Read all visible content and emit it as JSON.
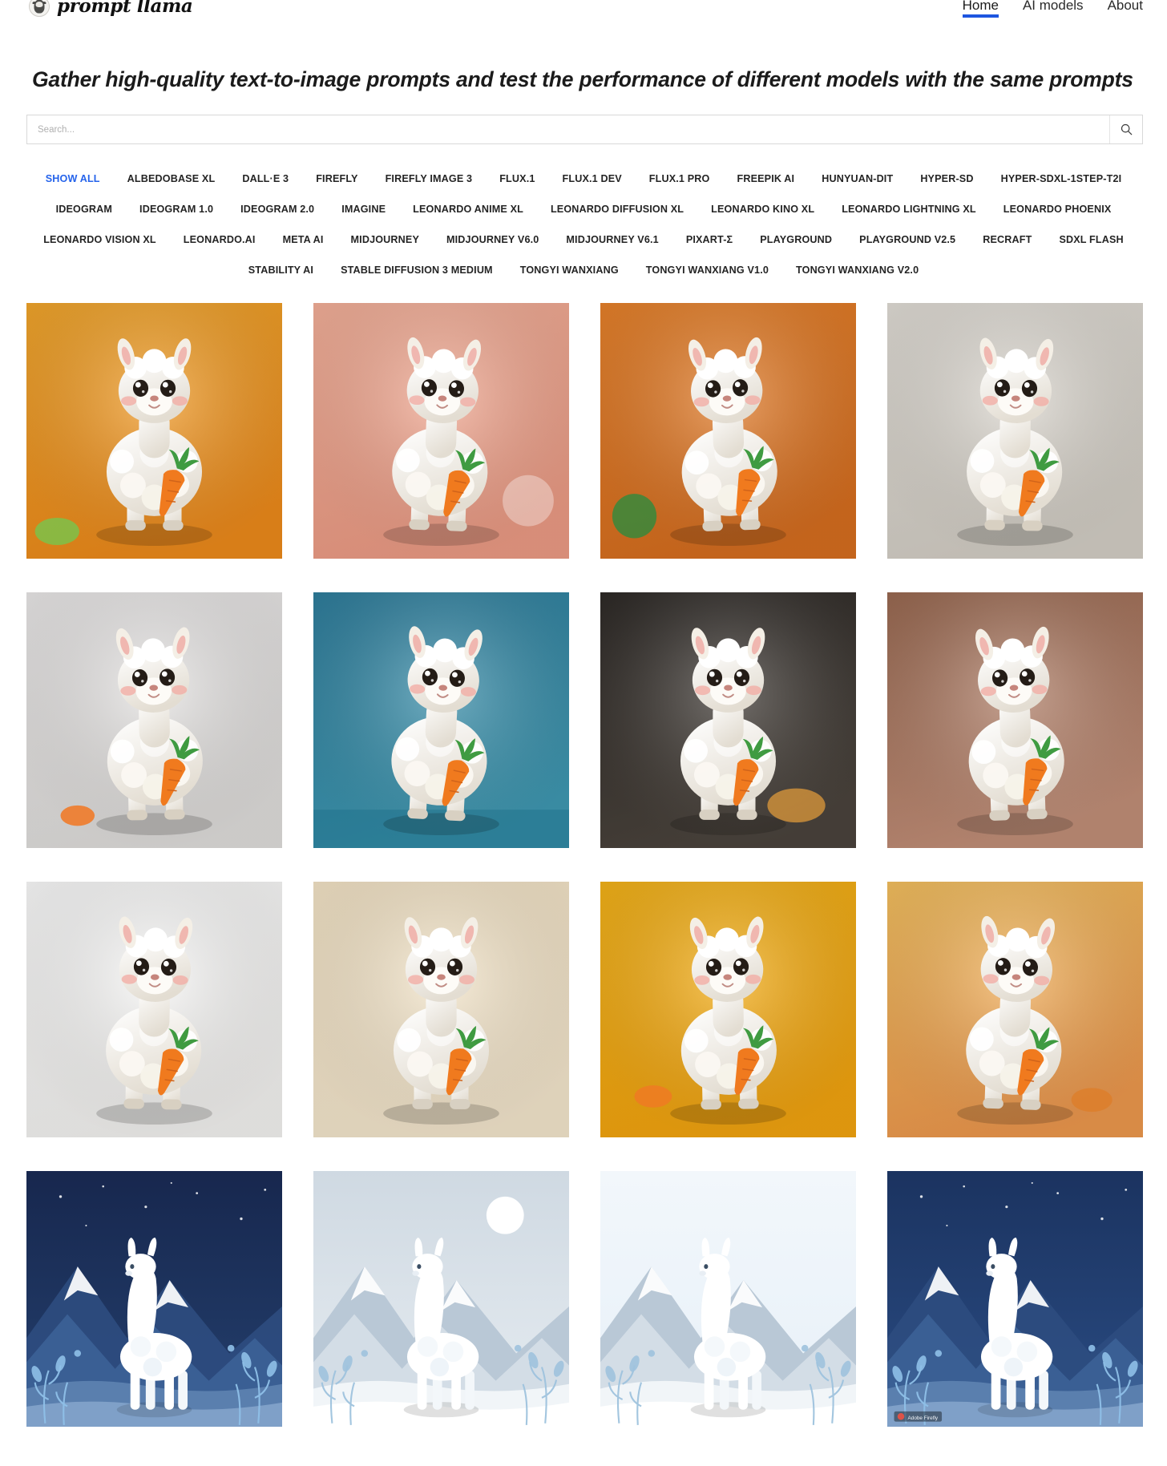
{
  "brand": {
    "name": "prompt llama",
    "logo_icon": "llama-avatar-icon"
  },
  "nav": {
    "items": [
      {
        "label": "Home",
        "active": true
      },
      {
        "label": "AI models",
        "active": false
      },
      {
        "label": "About",
        "active": false
      }
    ],
    "active_underline_color": "#1e56e0"
  },
  "headline": "Gather high-quality text-to-image prompts and test the performance of different models with the same prompts",
  "search": {
    "placeholder": "Search...",
    "value": "",
    "button_icon": "search-icon"
  },
  "filters": {
    "active": "SHOW ALL",
    "active_color": "#2563eb",
    "items": [
      "SHOW ALL",
      "ALBEDOBASE XL",
      "DALL·E 3",
      "FIREFLY",
      "FIREFLY IMAGE 3",
      "FLUX.1",
      "FLUX.1 DEV",
      "FLUX.1 PRO",
      "FREEPIK AI",
      "HUNYUAN-DIT",
      "HYPER-SD",
      "HYPER-SDXL-1STEP-T2I",
      "IDEOGRAM",
      "IDEOGRAM 1.0",
      "IDEOGRAM 2.0",
      "IMAGINE",
      "LEONARDO ANIME XL",
      "LEONARDO DIFFUSION XL",
      "LEONARDO KINO XL",
      "LEONARDO LIGHTNING XL",
      "LEONARDO PHOENIX",
      "LEONARDO VISION XL",
      "LEONARDO.AI",
      "META AI",
      "MIDJOURNEY",
      "MIDJOURNEY V6.0",
      "MIDJOURNEY V6.1",
      "PIXART-Σ",
      "PLAYGROUND",
      "PLAYGROUND V2.5",
      "RECRAFT",
      "SDXL FLASH",
      "STABILITY AI",
      "STABLE DIFFUSION 3 MEDIUM",
      "TONGYI WANXIANG",
      "TONGYI WANXIANG V1.0",
      "TONGYI WANXIANG V2.0"
    ]
  },
  "gallery": {
    "columns": 4,
    "items": [
      {
        "alt": "white llama figurine holding carrot on orange stage with succulent",
        "bg_top": "#f4a72b",
        "bg_bottom": "#f08c1b",
        "style": "toy"
      },
      {
        "alt": "fluffy llama plush toy with carrot on pink podium, peach background",
        "bg_top": "#f6b19a",
        "bg_bottom": "#ef9d86",
        "style": "toy"
      },
      {
        "alt": "llama figurine with carrot among cactus and pumpkins, orange background",
        "bg_top": "#e9822a",
        "bg_bottom": "#d96f1f",
        "style": "toy"
      },
      {
        "alt": "white woolly llama figurine holding carrot on soft grey studio background",
        "bg_top": "#e3dfd8",
        "bg_bottom": "#d6d1c8",
        "style": "toy"
      },
      {
        "alt": "white llama figurine with orange scarf and carrots on light grey set",
        "bg_top": "#eceaea",
        "bg_bottom": "#e2e0de",
        "style": "toy"
      },
      {
        "alt": "detailed llama figurine with carrot wearing blue outfit, teal background",
        "bg_top": "#2f7f9e",
        "bg_bottom": "#3f9ab4",
        "style": "toy"
      },
      {
        "alt": "white llama figurine with bread and oranges, dark moody background",
        "bg_top": "#2e2a27",
        "bg_bottom": "#4b443d",
        "style": "toy"
      },
      {
        "alt": "white llama figurine holding large carrot, warm brown gradient background",
        "bg_top": "#9b6a52",
        "bg_bottom": "#c49079",
        "style": "toy"
      },
      {
        "alt": "cream llama figurine holding carrot on plain white background",
        "bg_top": "#fdfdfd",
        "bg_bottom": "#f6f5f3",
        "style": "toy"
      },
      {
        "alt": "white llama figurine holding carrot on soft cream gradient background",
        "bg_top": "#f6e6c8",
        "bg_bottom": "#f7e9cf",
        "style": "toy"
      },
      {
        "alt": "white llama figurine eating carrot on bright yellow background",
        "bg_top": "#f6b418",
        "bg_bottom": "#f5a60f",
        "style": "toy"
      },
      {
        "alt": "white llama figurine with carrot bunch on warm orange gradient",
        "bg_top": "#f6c15f",
        "bg_bottom": "#f09a4e",
        "style": "toy"
      },
      {
        "alt": "illustrated white llama in snowy blue mountain landscape at night",
        "bg_top": "#17274e",
        "bg_bottom": "#24406e",
        "style": "winter"
      },
      {
        "alt": "flat illustration of white llama in pale blue snowy mountains with moon",
        "bg_top": "#cfd9e2",
        "bg_bottom": "#e6ecf1",
        "style": "winter"
      },
      {
        "alt": "white llama surrounded by blue botanical foliage illustration",
        "bg_top": "#f2f7fb",
        "bg_bottom": "#e7f0f8",
        "style": "winter"
      },
      {
        "alt": "white llama in blue mountain landscape with white flowers, Adobe Firefly watermark",
        "bg_top": "#1b3360",
        "bg_bottom": "#2a4c83",
        "style": "winter"
      }
    ]
  }
}
